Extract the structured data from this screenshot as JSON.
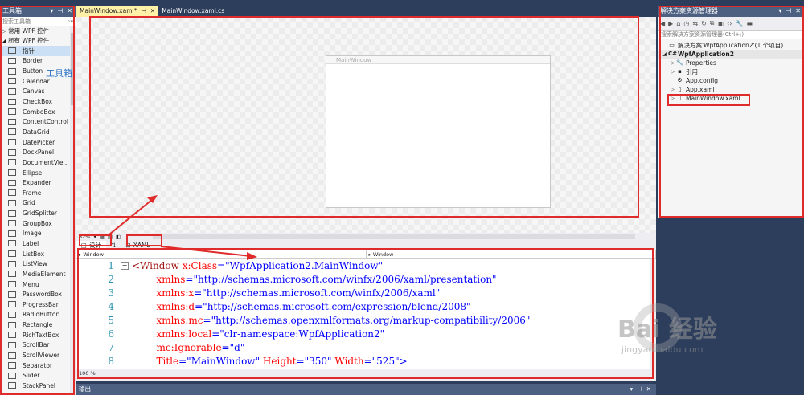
{
  "toolbox": {
    "title": "工具箱",
    "search_placeholder": "搜索工具箱",
    "groups": [
      "常用 WPF 控件",
      "所有 WPF 控件"
    ],
    "annotation": "工具箱",
    "items": [
      {
        "label": "指针",
        "icon": "pointer-icon"
      },
      {
        "label": "Border",
        "icon": "border-icon"
      },
      {
        "label": "Button",
        "icon": "button-icon"
      },
      {
        "label": "Calendar",
        "icon": "calendar-icon"
      },
      {
        "label": "Canvas",
        "icon": "canvas-icon"
      },
      {
        "label": "CheckBox",
        "icon": "checkbox-icon"
      },
      {
        "label": "ComboBox",
        "icon": "combobox-icon"
      },
      {
        "label": "ContentControl",
        "icon": "contentcontrol-icon"
      },
      {
        "label": "DataGrid",
        "icon": "datagrid-icon"
      },
      {
        "label": "DatePicker",
        "icon": "datepicker-icon"
      },
      {
        "label": "DockPanel",
        "icon": "dockpanel-icon"
      },
      {
        "label": "DocumentVie...",
        "icon": "documentviewer-icon"
      },
      {
        "label": "Ellipse",
        "icon": "ellipse-icon"
      },
      {
        "label": "Expander",
        "icon": "expander-icon"
      },
      {
        "label": "Frame",
        "icon": "frame-icon"
      },
      {
        "label": "Grid",
        "icon": "grid-icon"
      },
      {
        "label": "GridSplitter",
        "icon": "gridsplitter-icon"
      },
      {
        "label": "GroupBox",
        "icon": "groupbox-icon"
      },
      {
        "label": "Image",
        "icon": "image-icon"
      },
      {
        "label": "Label",
        "icon": "label-icon"
      },
      {
        "label": "ListBox",
        "icon": "listbox-icon"
      },
      {
        "label": "ListView",
        "icon": "listview-icon"
      },
      {
        "label": "MediaElement",
        "icon": "mediaelement-icon"
      },
      {
        "label": "Menu",
        "icon": "menu-icon"
      },
      {
        "label": "PasswordBox",
        "icon": "passwordbox-icon"
      },
      {
        "label": "ProgressBar",
        "icon": "progressbar-icon"
      },
      {
        "label": "RadioButton",
        "icon": "radiobutton-icon"
      },
      {
        "label": "Rectangle",
        "icon": "rectangle-icon"
      },
      {
        "label": "RichTextBox",
        "icon": "richtextbox-icon"
      },
      {
        "label": "ScrollBar",
        "icon": "scrollbar-icon"
      },
      {
        "label": "ScrollViewer",
        "icon": "scrollviewer-icon"
      },
      {
        "label": "Separator",
        "icon": "separator-icon"
      },
      {
        "label": "Slider",
        "icon": "slider-icon"
      },
      {
        "label": "StackPanel",
        "icon": "stackpanel-icon"
      }
    ]
  },
  "editor": {
    "tabs": [
      {
        "label": "MainWindow.xaml*",
        "active": true
      },
      {
        "label": "MainWindow.xaml.cs",
        "active": false
      }
    ],
    "designer_window_title": "MainWindow",
    "zoom_top": "82%",
    "view_tabs": {
      "design": "设计",
      "xaml": "XAML"
    },
    "selector_left": "Window",
    "selector_right": "Window",
    "zoom_bottom": "100 %",
    "code_lines": [
      {
        "n": "1",
        "parts": [
          [
            "tb",
            "<Window "
          ],
          [
            "at",
            "x:Class"
          ],
          [
            "pn",
            "=\""
          ],
          [
            "vl",
            "WpfApplication2.MainWindow"
          ],
          [
            "pn",
            "\""
          ]
        ]
      },
      {
        "n": "2",
        "parts": [
          [
            "at",
            "        xmlns"
          ],
          [
            "pn",
            "=\""
          ],
          [
            "vl",
            "http://schemas.microsoft.com/winfx/2006/xaml/presentation"
          ],
          [
            "pn",
            "\""
          ]
        ]
      },
      {
        "n": "3",
        "parts": [
          [
            "at",
            "        xmlns:x"
          ],
          [
            "pn",
            "=\""
          ],
          [
            "vl",
            "http://schemas.microsoft.com/winfx/2006/xaml"
          ],
          [
            "pn",
            "\""
          ]
        ]
      },
      {
        "n": "4",
        "parts": [
          [
            "at",
            "        xmlns:d"
          ],
          [
            "pn",
            "=\""
          ],
          [
            "vl",
            "http://schemas.microsoft.com/expression/blend/2008"
          ],
          [
            "pn",
            "\""
          ]
        ]
      },
      {
        "n": "5",
        "parts": [
          [
            "at",
            "        xmlns:mc"
          ],
          [
            "pn",
            "=\""
          ],
          [
            "vl",
            "http://schemas.openxmlformats.org/markup-compatibility/2006"
          ],
          [
            "pn",
            "\""
          ]
        ]
      },
      {
        "n": "6",
        "parts": [
          [
            "at",
            "        xmlns:local"
          ],
          [
            "pn",
            "=\""
          ],
          [
            "vl",
            "clr-namespace:WpfApplication2"
          ],
          [
            "pn",
            "\""
          ]
        ]
      },
      {
        "n": "7",
        "parts": [
          [
            "at",
            "        mc:Ignorable"
          ],
          [
            "pn",
            "=\""
          ],
          [
            "vl",
            "d"
          ],
          [
            "pn",
            "\""
          ]
        ]
      },
      {
        "n": "8",
        "parts": [
          [
            "at",
            "        Title"
          ],
          [
            "pn",
            "=\""
          ],
          [
            "vl",
            "MainWindow"
          ],
          [
            "pn",
            "\" "
          ],
          [
            "at",
            "Height"
          ],
          [
            "pn",
            "=\""
          ],
          [
            "vl",
            "350"
          ],
          [
            "pn",
            "\" "
          ],
          [
            "at",
            "Width"
          ],
          [
            "pn",
            "=\""
          ],
          [
            "vl",
            "525"
          ],
          [
            "pn",
            "\">"
          ]
        ]
      }
    ]
  },
  "output": {
    "title": "输出"
  },
  "solution": {
    "title": "解决方案资源管理器",
    "search_placeholder": "搜索解决方案资源管理器(Ctrl+;)",
    "tree": [
      {
        "label": "解决方案'WpfApplication2'(1 个项目)",
        "depth": 0,
        "twisty": "",
        "icon": "▭"
      },
      {
        "label": "WpfApplication2",
        "depth": 0,
        "twisty": "◢",
        "icon": "C#",
        "selected": true
      },
      {
        "label": "Properties",
        "depth": 1,
        "twisty": "▷",
        "icon": "🔧"
      },
      {
        "label": "引用",
        "depth": 1,
        "twisty": "▷",
        "icon": "▪"
      },
      {
        "label": "App.config",
        "depth": 1,
        "twisty": "",
        "icon": "⚙"
      },
      {
        "label": "App.xaml",
        "depth": 1,
        "twisty": "▷",
        "icon": "▯"
      },
      {
        "label": "MainWindow.xaml",
        "depth": 1,
        "twisty": "▷",
        "icon": "▯"
      }
    ]
  },
  "watermark": {
    "main": "Bai 经验",
    "sub": "jingyan.baidu.com"
  },
  "colors": {
    "annotation_red": "#e02b2b",
    "ide_frame": "#2d3e5c",
    "tab_active": "#fff1a8"
  }
}
